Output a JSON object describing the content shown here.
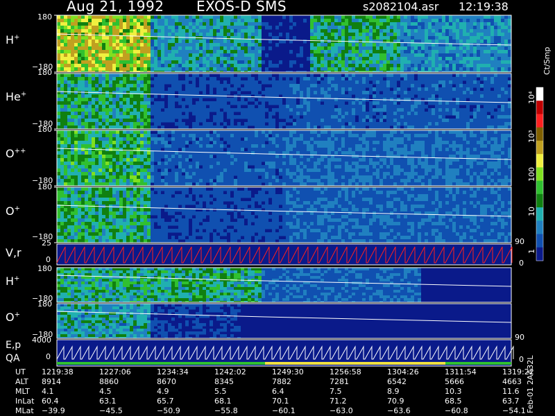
{
  "header": {
    "date": "Aug 21, 1992",
    "instrument": "EXOS-D SMS",
    "file": "s2082104.asr",
    "time": "12:19:38"
  },
  "colors": {
    "background": "#000000",
    "panel_base": "#0a1a8a",
    "trace": "#ffffff",
    "velocity_trace": "#ff2020",
    "qa_bar_good": "#30c030",
    "qa_bar_warn": "#f0e040"
  },
  "colorbar": {
    "unit": "Ct/Smp",
    "tick_labels": [
      "10⁴",
      "10³",
      "100",
      "10",
      "1"
    ],
    "colors": [
      "#ffffff",
      "#c00000",
      "#ff2020",
      "#806000",
      "#c0a020",
      "#f0f040",
      "#80e020",
      "#30c030",
      "#108010",
      "#20b0b0",
      "#2080c0",
      "#1050b0",
      "#0a1a8a"
    ]
  },
  "panels": [
    {
      "label": "H",
      "charge": "+",
      "ymax": "180",
      "ymin": "−180"
    },
    {
      "label": "He",
      "charge": "+",
      "ymax": "180",
      "ymin": "−180"
    },
    {
      "label": "O",
      "charge": "++",
      "ymax": "180",
      "ymin": "−180"
    },
    {
      "label": "O",
      "charge": "+",
      "ymax": "180",
      "ymin": "−180"
    },
    {
      "label": "V,r",
      "charge": "",
      "ymax": "25",
      "ymin": "0",
      "right_top": "90",
      "right_bottom": "0"
    },
    {
      "label": "H",
      "charge": "+",
      "ymax": "180",
      "ymin": "−180"
    },
    {
      "label": "O",
      "charge": "+",
      "ymax": "180",
      "ymin": "−180",
      "right_top": "90",
      "right_bottom": "0"
    },
    {
      "label": "E,p",
      "label2": "QA",
      "charge": "",
      "ymax": "4000",
      "ymin": "0",
      "right_bottom": "0"
    }
  ],
  "footer_side_text": "Feb-01  2AA32L",
  "chart_data": {
    "type": "table",
    "title": "Aug 21, 1992   EXOS-D SMS",
    "rows": [
      {
        "name": "UT",
        "values": [
          "1219:38",
          "1227:06",
          "1234:34",
          "1242:02",
          "1249:30",
          "1256:58",
          "1304:26",
          "1311:54",
          "1319:22"
        ]
      },
      {
        "name": "ALT",
        "values": [
          "8914",
          "8860",
          "8670",
          "8345",
          "7882",
          "7281",
          "6542",
          "5666",
          "4663"
        ]
      },
      {
        "name": "MLT",
        "values": [
          "4.1",
          "4.5",
          "4.9",
          "5.5",
          "6.4",
          "7.5",
          "8.9",
          "10.3",
          "11.6"
        ]
      },
      {
        "name": "InLat",
        "values": [
          "60.4",
          "63.1",
          "65.7",
          "68.1",
          "70.1",
          "71.2",
          "70.9",
          "68.5",
          "63.7"
        ]
      },
      {
        "name": "MLat",
        "values": [
          "−39.9",
          "−45.5",
          "−50.9",
          "−55.8",
          "−60.1",
          "−63.0",
          "−63.6",
          "−60.8",
          "−54.1"
        ]
      }
    ]
  }
}
